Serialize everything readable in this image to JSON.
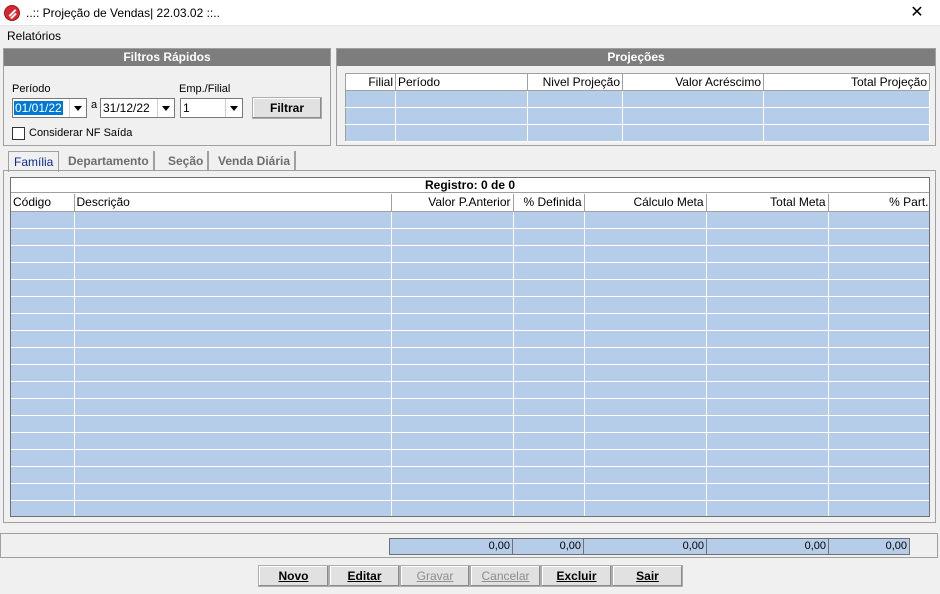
{
  "window": {
    "title": "..:: Projeção de Vendas| 22.03.02 ::..",
    "close": "✕"
  },
  "menu": {
    "items": [
      "Relatórios"
    ]
  },
  "filters": {
    "header": "Filtros Rápidos",
    "period_label": "Período",
    "date_from": "01/01/22",
    "separator": "a",
    "date_to": "31/12/22",
    "emp_label": "Emp./Filial",
    "emp_value": "1",
    "filter_button": "Filtrar",
    "checkbox_label": "Considerar NF Saída",
    "checkbox_checked": false
  },
  "projections": {
    "header": "Projeções",
    "columns": [
      "Filial",
      "Período",
      "Nivel Projeção",
      "Valor Acréscimo",
      "Total Projeção"
    ],
    "rows": 3
  },
  "tabs": [
    {
      "label": "Família",
      "active": true
    },
    {
      "label": "Departamento",
      "active": false
    },
    {
      "label": "Seção",
      "active": false
    },
    {
      "label": "Venda Diária",
      "active": false
    }
  ],
  "main_grid": {
    "registro": "Registro: 0 de 0",
    "columns": [
      "Código",
      "Descrição",
      "Valor P.Anterior",
      "% Definida",
      "Cálculo Meta",
      "Total Meta",
      "% Part."
    ],
    "rows": 18
  },
  "totals": [
    "0,00",
    "0,00",
    "0,00",
    "0,00",
    "0,00"
  ],
  "buttons": {
    "novo": {
      "label": "Novo",
      "enabled": true
    },
    "editar": {
      "label": "Editar",
      "enabled": true
    },
    "gravar": {
      "label": "Gravar",
      "enabled": false
    },
    "cancelar": {
      "label": "Cancelar",
      "enabled": false
    },
    "excluir": {
      "label": "Excluir",
      "enabled": true
    },
    "sair": {
      "label": "Sair",
      "enabled": true
    }
  },
  "colors": {
    "grid_fill": "#b5cde8",
    "group_header": "#7d7d7d",
    "active_tab": "#0d2a8c"
  }
}
